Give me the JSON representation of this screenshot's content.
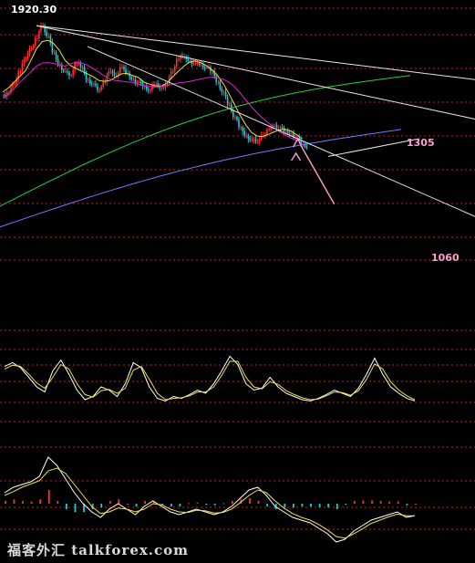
{
  "chart_data": [
    {
      "type": "candlestick",
      "title": "",
      "xlabel": "",
      "ylabel": "",
      "ylim": [
        900,
        2000
      ],
      "grid": "horizontal dashed red lines",
      "annotations": {
        "high_label": "1920.30",
        "high_value": 1920.3,
        "target_a_label": "1305",
        "target_a": 1305,
        "target_b_label": "1060",
        "target_b": 1060
      },
      "lines": [
        {
          "name": "",
          "role": "moving average",
          "color": "#f0e040"
        },
        {
          "name": "",
          "role": "moving average",
          "color": "#e020d0"
        },
        {
          "name": "",
          "role": "moving average",
          "color": "#20d040"
        },
        {
          "name": "",
          "role": "moving average",
          "color": "#7777ff"
        },
        {
          "name": "",
          "role": "trendline",
          "color": "#e8e8e8"
        },
        {
          "name": "",
          "role": "forecast arrow",
          "color": "#ff9ed0"
        }
      ],
      "series_close": [
        1600,
        1640,
        1700,
        1760,
        1810,
        1860,
        1920,
        1870,
        1790,
        1730,
        1700,
        1680,
        1740,
        1720,
        1660,
        1640,
        1610,
        1650,
        1700,
        1680,
        1720,
        1690,
        1660,
        1650,
        1630,
        1610,
        1640,
        1620,
        1640,
        1700,
        1760,
        1770,
        1750,
        1740,
        1730,
        1720,
        1700,
        1650,
        1600,
        1540,
        1480,
        1430,
        1390,
        1370,
        1360,
        1390,
        1420,
        1440,
        1430,
        1410,
        1400,
        1380,
        1350,
        1335
      ]
    },
    {
      "type": "line",
      "title": "",
      "role": "oscillator",
      "ylim": [
        0,
        100
      ],
      "series": [
        {
          "name": "",
          "color": "#ffffff",
          "values": [
            72,
            78,
            70,
            55,
            40,
            32,
            65,
            82,
            60,
            35,
            20,
            25,
            40,
            35,
            25,
            45,
            78,
            70,
            40,
            22,
            18,
            25,
            22,
            28,
            35,
            30,
            45,
            65,
            88,
            75,
            45,
            35,
            38,
            55,
            40,
            30,
            25,
            20,
            18,
            22,
            28,
            35,
            30,
            25,
            38,
            60,
            85,
            60,
            40,
            30,
            22,
            18
          ]
        },
        {
          "name": "",
          "color": "#f0e040",
          "values": [
            68,
            74,
            72,
            60,
            46,
            38,
            55,
            75,
            68,
            45,
            28,
            24,
            34,
            36,
            30,
            38,
            66,
            72,
            52,
            30,
            20,
            22,
            23,
            26,
            32,
            32,
            40,
            58,
            80,
            80,
            55,
            40,
            37,
            48,
            44,
            34,
            28,
            23,
            20,
            21,
            26,
            32,
            31,
            27,
            34,
            52,
            76,
            68,
            48,
            35,
            26,
            20
          ]
        }
      ]
    },
    {
      "type": "bar",
      "title": "",
      "role": "MACD",
      "ylim": [
        -1,
        1
      ],
      "series": [
        {
          "name": "",
          "color": "#ffffff",
          "values": [
            0.2,
            0.3,
            0.35,
            0.4,
            0.5,
            0.85,
            0.7,
            0.45,
            0.2,
            0.0,
            -0.15,
            -0.25,
            -0.1,
            0.0,
            -0.1,
            -0.2,
            -0.05,
            0.05,
            -0.05,
            -0.15,
            -0.2,
            -0.15,
            -0.1,
            -0.15,
            -0.2,
            -0.15,
            -0.05,
            0.1,
            0.25,
            0.3,
            0.15,
            -0.05,
            -0.15,
            -0.25,
            -0.3,
            -0.35,
            -0.45,
            -0.55,
            -0.7,
            -0.65,
            -0.5,
            -0.4,
            -0.3,
            -0.25,
            -0.2,
            -0.15,
            -0.25,
            -0.22
          ]
        },
        {
          "name": "",
          "color": "#f0e040",
          "values": [
            0.15,
            0.22,
            0.3,
            0.36,
            0.42,
            0.6,
            0.65,
            0.55,
            0.35,
            0.15,
            -0.05,
            -0.18,
            -0.15,
            -0.08,
            -0.1,
            -0.15,
            -0.1,
            0.0,
            -0.02,
            -0.1,
            -0.15,
            -0.16,
            -0.12,
            -0.13,
            -0.17,
            -0.16,
            -0.1,
            0.02,
            0.15,
            0.25,
            0.2,
            0.05,
            -0.08,
            -0.18,
            -0.25,
            -0.3,
            -0.38,
            -0.48,
            -0.6,
            -0.63,
            -0.55,
            -0.46,
            -0.36,
            -0.3,
            -0.24,
            -0.19,
            -0.22,
            -0.22
          ]
        },
        {
          "name": "",
          "role": "histogram",
          "values": [
            0.05,
            0.08,
            0.05,
            0.04,
            0.08,
            0.25,
            0.05,
            -0.1,
            -0.15,
            -0.15,
            -0.1,
            -0.07,
            0.05,
            0.08,
            0.0,
            -0.05,
            0.05,
            0.05,
            -0.03,
            -0.05,
            -0.05,
            0.01,
            0.02,
            -0.02,
            -0.03,
            0.01,
            0.05,
            0.08,
            0.1,
            0.05,
            -0.05,
            -0.1,
            -0.07,
            -0.07,
            -0.05,
            -0.05,
            -0.07,
            -0.07,
            -0.1,
            -0.02,
            0.05,
            0.06,
            0.06,
            0.05,
            0.04,
            0.04,
            -0.03,
            0.0
          ]
        }
      ]
    }
  ],
  "watermark": "福客外汇 talkforex.com",
  "colors": {
    "background": "#000000",
    "grid": "#c02020",
    "up_candle": "#ff3030",
    "down_candle": "#10d0e0",
    "hist_up": "#ff3030",
    "hist_down": "#10d0e0"
  }
}
